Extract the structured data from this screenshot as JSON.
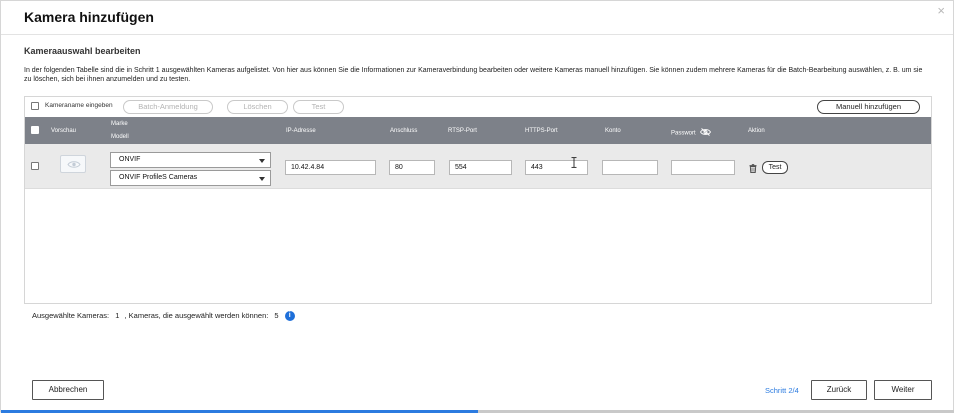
{
  "dialog": {
    "title": "Kamera hinzufügen",
    "close_glyph": "×"
  },
  "section": {
    "title": "Kameraauswahl bearbeiten",
    "description": "In der folgenden Tabelle sind die in Schritt 1 ausgewählten Kameras aufgelistet. Von hier aus können Sie die Informationen zur Kameraverbindung bearbeiten oder weitere Kameras manuell hinzufügen. Sie können zudem mehrere Kameras für die Batch-Bearbeitung auswählen, z. B. um sie zu löschen, sich bei ihnen anzumelden und zu testen."
  },
  "toolbar": {
    "camera_name_label": "Kameraname eingeben",
    "batch_login": "Batch-Anmeldung",
    "delete": "Löschen",
    "test": "Test",
    "add_manually": "Manuell hinzufügen"
  },
  "table": {
    "headers": {
      "preview": "Vorschau",
      "brand": "Marke",
      "model": "Modell",
      "ip": "IP-Adresse",
      "port": "Anschluss",
      "rtsp": "RTSP-Port",
      "https": "HTTPS-Port",
      "account": "Konto",
      "password": "Passwort",
      "action": "Aktion"
    },
    "rows": [
      {
        "brand": "ONVIF",
        "model": "ONVIF ProfileS Cameras",
        "ip": "10.42.4.84",
        "port": "80",
        "rtsp": "554",
        "https": "443",
        "account": "",
        "password": "",
        "test": "Test"
      }
    ]
  },
  "status": {
    "prefix": "Ausgewählte Kameras:",
    "selected": "1",
    "middle": ", Kameras, die ausgewählt werden können:",
    "available": "5"
  },
  "footer": {
    "cancel": "Abbrechen",
    "step": "Schritt 2/4",
    "back": "Zurück",
    "next": "Weiter"
  },
  "progress": {
    "fraction": 0.5
  },
  "colors": {
    "accent": "#2b7be0",
    "table_header": "#7d8189",
    "row_bg": "#eaeaea",
    "info": "#1e6fd9"
  },
  "icons": {
    "close": "close-icon",
    "password_hidden": "eye-slash-icon",
    "preview": "eye-icon",
    "delete": "trash-icon",
    "info": "info-icon"
  }
}
